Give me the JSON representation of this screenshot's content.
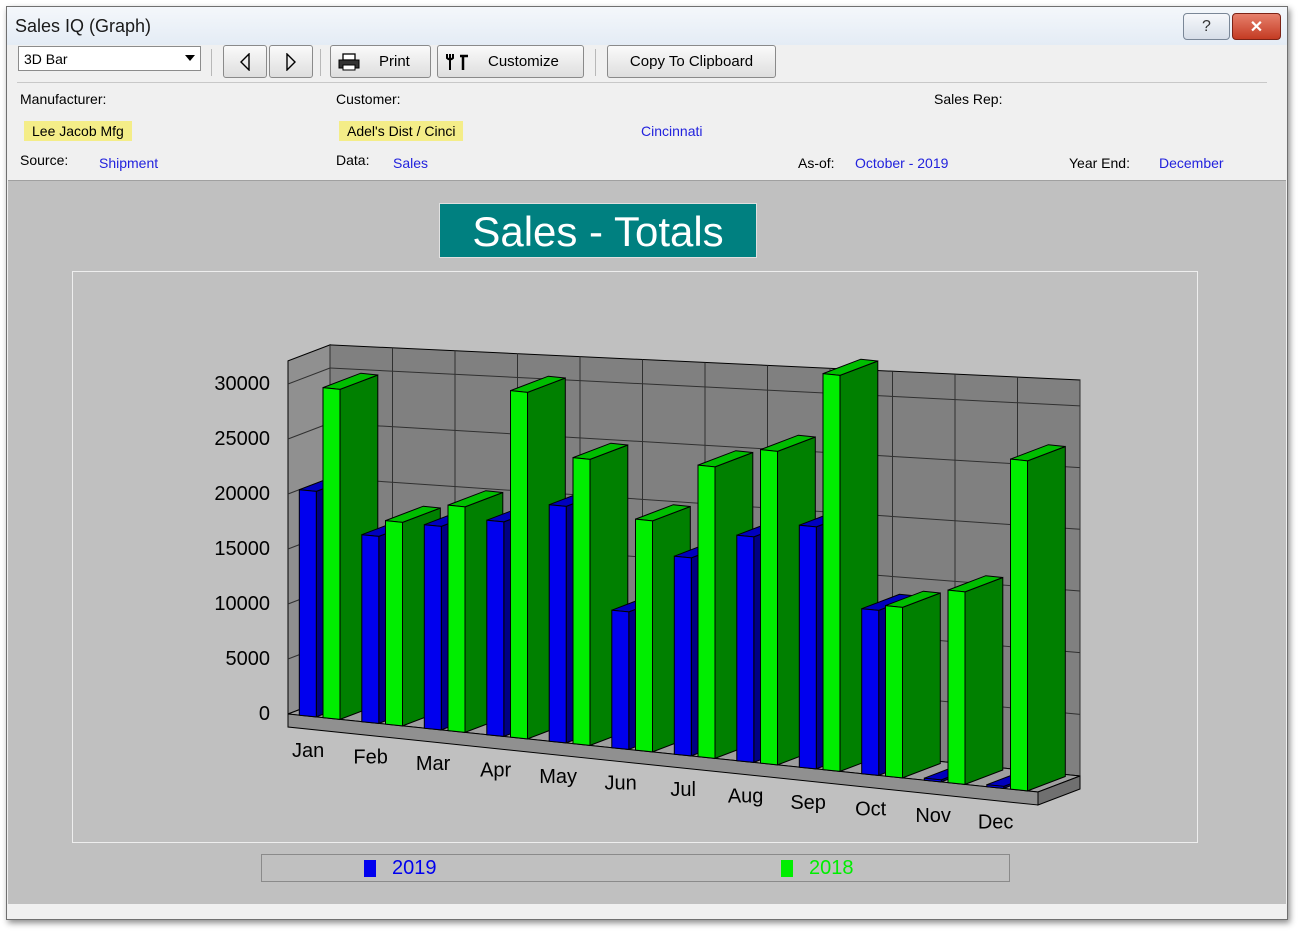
{
  "window": {
    "title": "Sales IQ (Graph)",
    "help_glyph": "?",
    "close_glyph": "✕"
  },
  "toolbar": {
    "graph_type": "3D Bar",
    "print_label": "Print",
    "customize_label": "Customize",
    "copy_label": "Copy To Clipboard"
  },
  "info": {
    "manufacturer_label": "Manufacturer:",
    "manufacturer_value": "Lee Jacob Mfg",
    "customer_label": "Customer:",
    "customer_value": "Adel's Dist / Cinci",
    "customer_city": "Cincinnati",
    "sales_rep_label": "Sales Rep:",
    "source_label": "Source:",
    "source_value": "Shipment",
    "data_label": "Data:",
    "data_value": "Sales",
    "asof_label": "As-of:",
    "asof_value": "October - 2019",
    "yearend_label": "Year End:",
    "yearend_value": "December"
  },
  "colors": {
    "series_2019": "#0000ee",
    "series_2018": "#00ee00",
    "series_2018_side": "#008000",
    "title_bg": "#008080",
    "wall": "#808080"
  },
  "chart_data": {
    "type": "bar",
    "title": "Sales - Totals",
    "categories": [
      "Jan",
      "Feb",
      "Mar",
      "Apr",
      "May",
      "Jun",
      "Jul",
      "Aug",
      "Sep",
      "Oct",
      "Nov",
      "Dec"
    ],
    "series": [
      {
        "name": "2019",
        "values": [
          20500,
          17000,
          18500,
          19500,
          21500,
          12500,
          18000,
          20500,
          22000,
          15000,
          0,
          0
        ]
      },
      {
        "name": "2018",
        "values": [
          30000,
          18500,
          20500,
          31500,
          26000,
          21000,
          26500,
          28500,
          36000,
          15500,
          17500,
          30000
        ]
      }
    ],
    "y_ticks": [
      0,
      5000,
      10000,
      15000,
      20000,
      25000,
      30000
    ],
    "ylim": [
      0,
      30000
    ],
    "legend_placement": "bottom",
    "grid": true
  }
}
